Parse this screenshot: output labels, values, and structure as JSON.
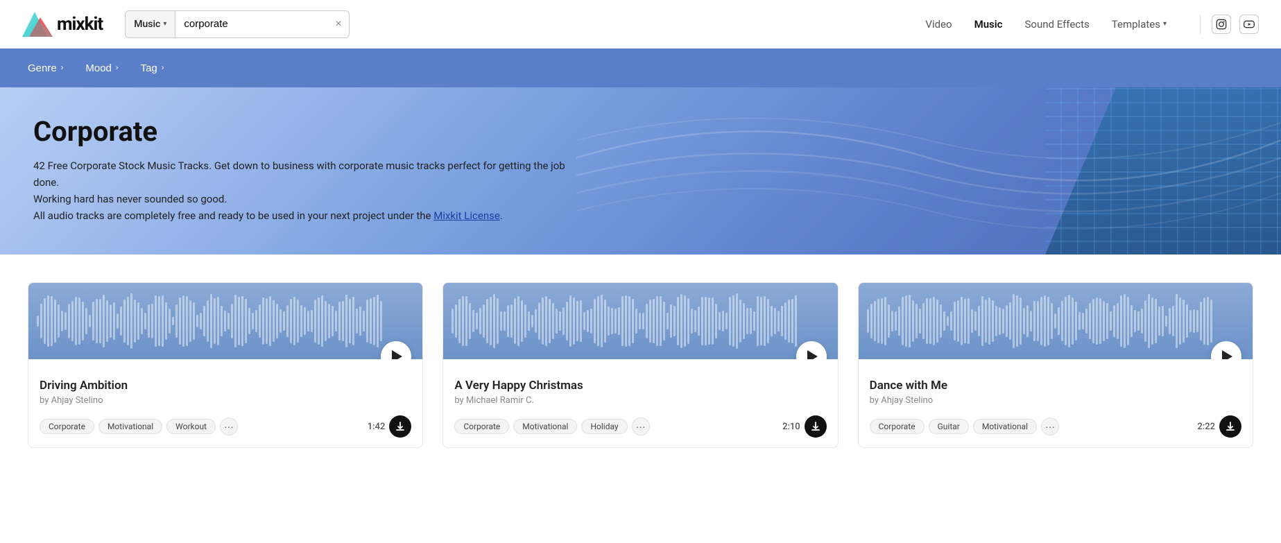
{
  "header": {
    "logo_text": "mixkit",
    "search": {
      "category": "Music",
      "query": "corporate",
      "clear_label": "×"
    },
    "nav": [
      {
        "id": "video",
        "label": "Video",
        "active": false
      },
      {
        "id": "music",
        "label": "Music",
        "active": true
      },
      {
        "id": "sound-effects",
        "label": "Sound Effects",
        "active": false
      },
      {
        "id": "templates",
        "label": "Templates",
        "active": false,
        "has_dropdown": true
      }
    ],
    "social": [
      {
        "id": "instagram",
        "icon": "⬜"
      },
      {
        "id": "youtube",
        "icon": "▶"
      }
    ]
  },
  "filters": [
    {
      "id": "genre",
      "label": "Genre"
    },
    {
      "id": "mood",
      "label": "Mood"
    },
    {
      "id": "tag",
      "label": "Tag"
    }
  ],
  "hero": {
    "title": "Corporate",
    "desc_line1": "42 Free Corporate Stock Music Tracks. Get down to business with corporate music tracks perfect for getting the job done.",
    "desc_line2": "Working hard has never sounded so good.",
    "desc_line3_pre": "All audio tracks are completely free and ready to be used in your next project under the ",
    "desc_link": "Mixkit License",
    "desc_line3_post": "."
  },
  "tracks": [
    {
      "id": "driving-ambition",
      "title": "Driving Ambition",
      "artist": "by Ahjay Stelino",
      "duration": "1:42",
      "tags": [
        "Corporate",
        "Motivational",
        "Workout"
      ]
    },
    {
      "id": "very-happy-christmas",
      "title": "A Very Happy Christmas",
      "artist": "by Michael Ramir C.",
      "duration": "2:10",
      "tags": [
        "Corporate",
        "Motivational",
        "Holiday"
      ]
    },
    {
      "id": "dance-with-me",
      "title": "Dance with Me",
      "artist": "by Ahjay Stelino",
      "duration": "2:22",
      "tags": [
        "Corporate",
        "Guitar",
        "Motivational"
      ]
    }
  ],
  "colors": {
    "filter_bar_bg": "#5b7ec9",
    "hero_bg_start": "#b8cef5",
    "hero_bg_end": "#4a6ab5",
    "waveform_bg": "#7a9fd4",
    "nav_active": "#111",
    "nav_inactive": "#555"
  }
}
